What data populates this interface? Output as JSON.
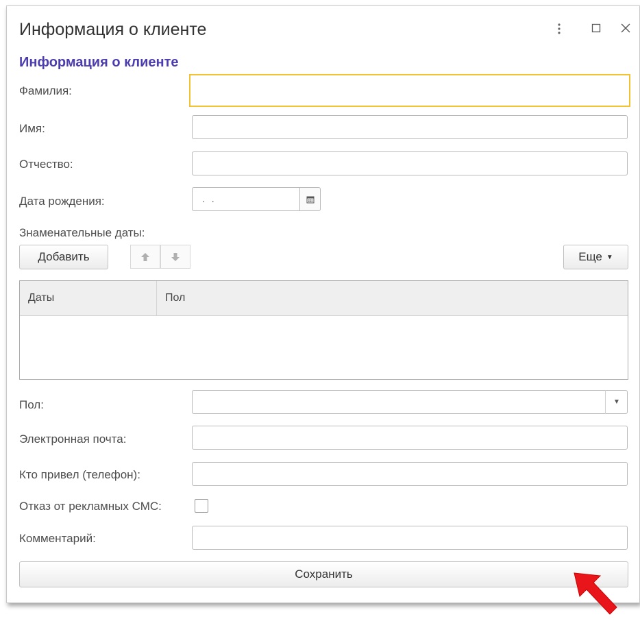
{
  "window": {
    "title": "Информация о клиенте"
  },
  "form": {
    "header": "Информация о клиенте",
    "surname_label": "Фамилия:",
    "name_label": "Имя:",
    "patronymic_label": "Отчество:",
    "birth_label": "Дата рождения:",
    "birth_value": ". .",
    "dates_label": "Знаменательные даты:",
    "add_button": "Добавить",
    "more_button": "Еще",
    "gender_label": "Пол:",
    "email_label": "Электронная почта:",
    "referrer_label": "Кто привел (телефон):",
    "sms_label": "Отказ от рекламных СМС:",
    "comment_label": "Комментарий:",
    "save_button": "Сохранить"
  },
  "table": {
    "columns": [
      "Даты",
      "Пол"
    ]
  },
  "colors": {
    "focus_border": "#f1c232",
    "header_text": "#4b3cb0",
    "pointer_arrow": "#e8161a"
  },
  "icons": [
    "kebab-menu-icon",
    "maximize-icon",
    "close-icon",
    "calendar-icon",
    "arrow-up-icon",
    "arrow-down-icon",
    "dropdown-caret-icon",
    "red-pointer-arrow"
  ]
}
